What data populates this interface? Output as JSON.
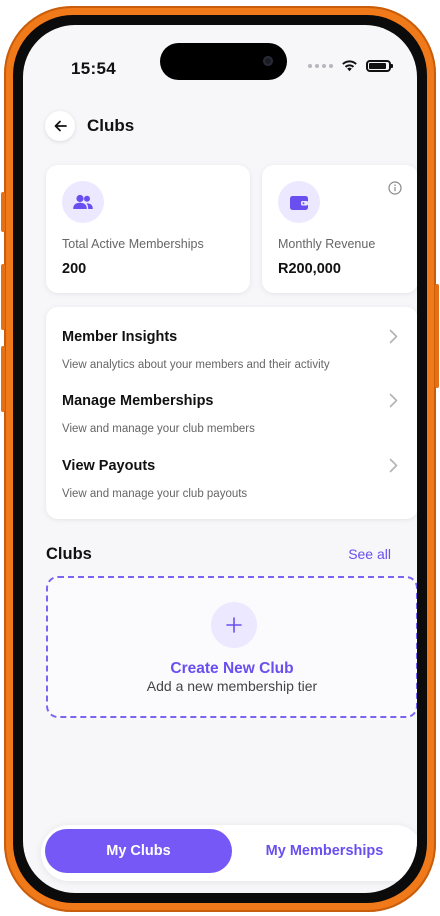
{
  "status_bar": {
    "time": "15:54"
  },
  "header": {
    "title": "Clubs"
  },
  "stats": [
    {
      "label": "Total Active Memberships",
      "value": "200",
      "icon": "members-icon"
    },
    {
      "label": "Monthly Revenue",
      "value": "R200,000",
      "icon": "wallet-icon"
    }
  ],
  "menu": [
    {
      "title": "Member Insights",
      "subtitle": "View analytics about your members and their activity"
    },
    {
      "title": "Manage Memberships",
      "subtitle": "View and manage your club members"
    },
    {
      "title": "View Payouts",
      "subtitle": "View and manage your club payouts"
    }
  ],
  "clubs": {
    "title": "Clubs",
    "see_all": "See all",
    "create_title": "Create New Club",
    "create_subtitle": "Add a new membership tier"
  },
  "tabs": [
    {
      "label": "My Clubs",
      "active": true
    },
    {
      "label": "My Memberships",
      "active": false
    }
  ],
  "colors": {
    "accent": "#7558f5",
    "accent_text": "#6a4ff0",
    "accent_soft": "#ece8ff",
    "frame": "#f07a1a"
  }
}
